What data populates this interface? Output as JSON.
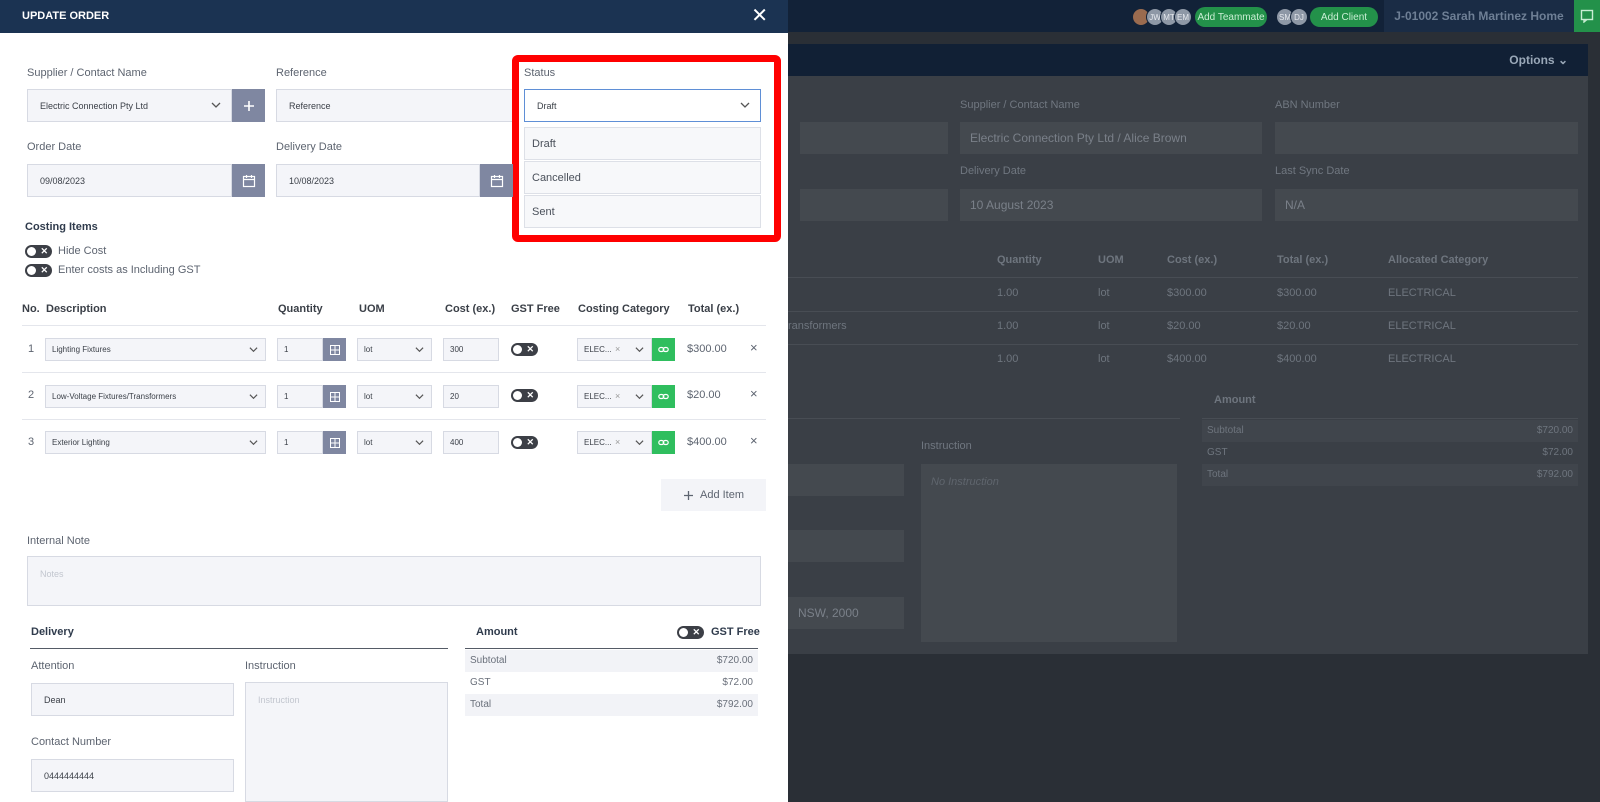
{
  "background": {
    "avatars_a": [
      "",
      "JW",
      "MT",
      "EM"
    ],
    "add_teammate": "Add Teammate",
    "avatars_b": [
      "SM",
      "DJ"
    ],
    "add_client": "Add Client",
    "job_title": "J-01002 Sarah Martinez Home",
    "options_label": "Options",
    "supplier_label": "Supplier / Contact Name",
    "supplier_value": "Electric Connection Pty Ltd / Alice Brown",
    "abn_label": "ABN Number",
    "delivery_date_label": "Delivery Date",
    "delivery_date_value": "10 August 2023",
    "last_sync_label": "Last Sync Date",
    "last_sync_value": "N/A",
    "table_headers": [
      "Quantity",
      "UOM",
      "Cost (ex.)",
      "Total (ex.)",
      "Allocated Category"
    ],
    "rows": [
      {
        "desc": "",
        "qty": "1.00",
        "uom": "lot",
        "cost": "$300.00",
        "total": "$300.00",
        "cat": "ELECTRICAL"
      },
      {
        "desc": "ransformers",
        "qty": "1.00",
        "uom": "lot",
        "cost": "$20.00",
        "total": "$20.00",
        "cat": "ELECTRICAL"
      },
      {
        "desc": "",
        "qty": "1.00",
        "uom": "lot",
        "cost": "$400.00",
        "total": "$400.00",
        "cat": "ELECTRICAL"
      }
    ],
    "instruction_label": "Instruction",
    "instruction_placeholder": "No Instruction",
    "address_fragment": "NSW, 2000",
    "amount_label": "Amount",
    "amounts": [
      {
        "label": "Subtotal",
        "value": "$720.00"
      },
      {
        "label": "GST",
        "value": "$72.00"
      },
      {
        "label": "Total",
        "value": "$792.00"
      }
    ]
  },
  "modal": {
    "title": "UPDATE ORDER",
    "supplier_label": "Supplier / Contact Name",
    "supplier_value": "Electric Connection Pty Ltd",
    "reference_label": "Reference",
    "reference_placeholder": "Reference",
    "status_label": "Status",
    "status_value": "Draft",
    "status_options": [
      "Draft",
      "Cancelled",
      "Sent"
    ],
    "order_date_label": "Order Date",
    "order_date_value": "09/08/2023",
    "delivery_date_label": "Delivery Date",
    "delivery_date_value": "10/08/2023",
    "costing_items_title": "Costing Items",
    "hide_cost_label": "Hide Cost",
    "incl_gst_label": "Enter costs as Including GST",
    "columns": [
      "No.",
      "Description",
      "Quantity",
      "UOM",
      "Cost (ex.)",
      "GST Free",
      "Costing Category",
      "Total (ex.)"
    ],
    "items": [
      {
        "no": "1",
        "desc": "Lighting Fixtures",
        "qty": "1",
        "uom": "lot",
        "cost": "300",
        "cat": "ELEC...",
        "total": "$300.00"
      },
      {
        "no": "2",
        "desc": "Low-Voltage Fixtures/Transformers",
        "qty": "1",
        "uom": "lot",
        "cost": "20",
        "cat": "ELEC...",
        "total": "$20.00"
      },
      {
        "no": "3",
        "desc": "Exterior Lighting",
        "qty": "1",
        "uom": "lot",
        "cost": "400",
        "cat": "ELEC...",
        "total": "$400.00"
      }
    ],
    "add_item_label": "Add Item",
    "internal_note_label": "Internal Note",
    "notes_placeholder": "Notes",
    "delivery_title": "Delivery",
    "attention_label": "Attention",
    "attention_value": "Dean",
    "instruction_label": "Instruction",
    "instruction_placeholder": "Instruction",
    "contact_label": "Contact Number",
    "contact_value": "0444444444",
    "amount_title": "Amount",
    "gst_free_label": "GST Free",
    "amounts": [
      {
        "label": "Subtotal",
        "value": "$720.00"
      },
      {
        "label": "GST",
        "value": "$72.00"
      },
      {
        "label": "Total",
        "value": "$792.00"
      }
    ]
  },
  "colors": {
    "header_navy": "#1b3352",
    "accent_green": "#2fbe5e",
    "highlight_red": "#ff0000",
    "button_slate": "#7f87a1"
  }
}
